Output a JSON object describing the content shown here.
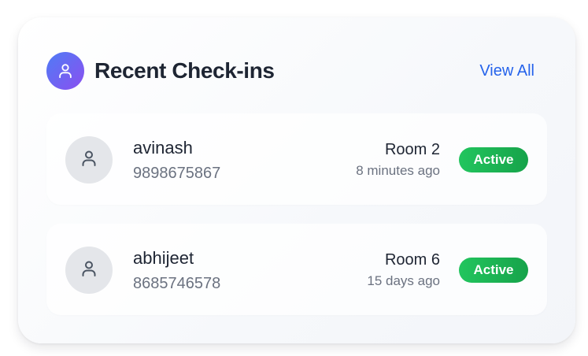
{
  "header": {
    "title": "Recent Check-ins",
    "view_all_label": "View All",
    "icon": "user-icon"
  },
  "checkins": [
    {
      "name": "avinash",
      "phone": "9898675867",
      "room": "Room 2",
      "time_ago": "8 minutes ago",
      "status": "Active"
    },
    {
      "name": "abhijeet",
      "phone": "8685746578",
      "room": "Room 6",
      "time_ago": "15 days ago",
      "status": "Active"
    }
  ],
  "colors": {
    "accent": "#2563eb",
    "status_active": "#22c55e",
    "icon_gradient_start": "#4f7cf5",
    "icon_gradient_end": "#8b4ff0"
  }
}
